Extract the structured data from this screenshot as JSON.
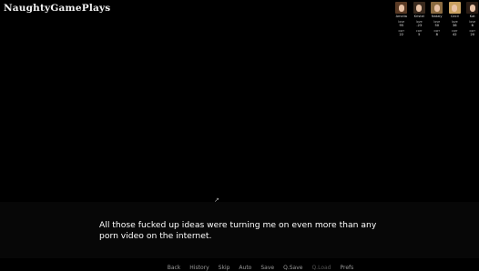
{
  "logo": "NaughtyGamePlays",
  "stat_labels": {
    "love": "love",
    "corr": "corr"
  },
  "characters": [
    {
      "name": "Amelia",
      "love": "95",
      "corr": "22",
      "hair": "#5a3a24"
    },
    {
      "name": "Kristel",
      "love": "-23",
      "corr": "5",
      "hair": "#3a2a1e"
    },
    {
      "name": "Nataly",
      "love": "50",
      "corr": "8",
      "hair": "#8a6a40"
    },
    {
      "name": "Cecil",
      "love": "36",
      "corr": "42",
      "hair": "#c8a060"
    },
    {
      "name": "Kat",
      "love": "6",
      "corr": "20",
      "hair": "#2a1c14"
    }
  ],
  "dialogue": "All those fucked up ideas were turning me on even more than any porn video on the internet.",
  "menu": [
    "Back",
    "History",
    "Skip",
    "Auto",
    "Save",
    "Q.Save",
    "Q.Load",
    "Prefs"
  ]
}
